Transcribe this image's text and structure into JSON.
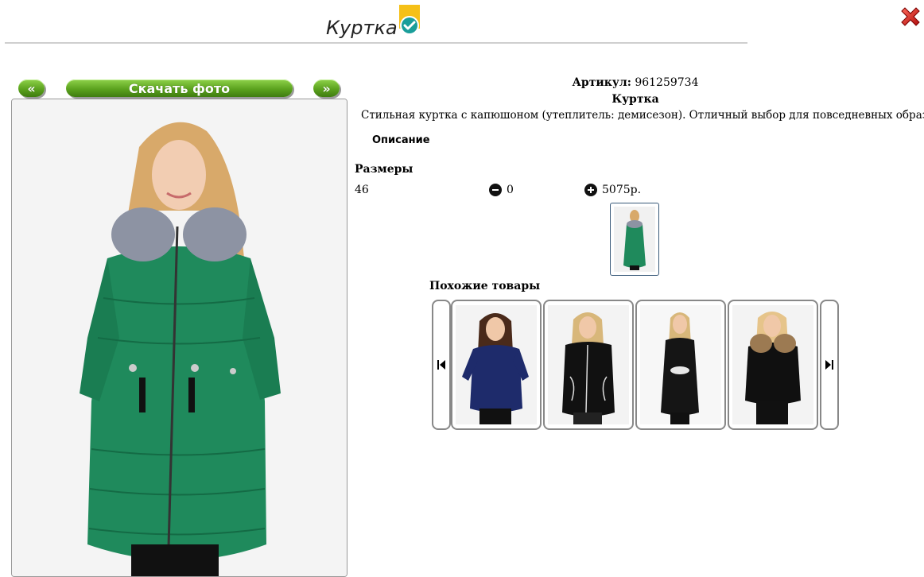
{
  "header": {
    "title": "Куртка",
    "badge_icon": "checkmark-badge-icon",
    "close_icon": "red-x-close-icon"
  },
  "gallery": {
    "prev_label": "«",
    "next_label": "»",
    "download_label": "Скачать фото",
    "button_color": "#5ba21e",
    "main_photo": "woman-green-coat-with-fur-hood"
  },
  "product": {
    "article_label": "Артикул:",
    "article_value": "961259734",
    "name": "Куртка",
    "description": "Стильная куртка с капюшоном (утеплитель: демисезон). Отличный выбор для повседневных образов",
    "description_tab": "Описание",
    "sizes_heading": "Размеры",
    "sizes": [
      {
        "size": "46",
        "qty": "0",
        "price": "5075р."
      }
    ]
  },
  "similar": {
    "heading": "Похожие товары",
    "items": [
      {
        "photo": "navy-puffer-jacket",
        "color": "#1e2b6b"
      },
      {
        "photo": "black-jacket-white-trim",
        "color": "#111111"
      },
      {
        "photo": "black-long-puffer-belt",
        "color": "#151515"
      },
      {
        "photo": "black-jacket-fur-hood",
        "color": "#101010"
      }
    ],
    "prev_icon": "skip-back-icon",
    "next_icon": "skip-forward-icon"
  }
}
